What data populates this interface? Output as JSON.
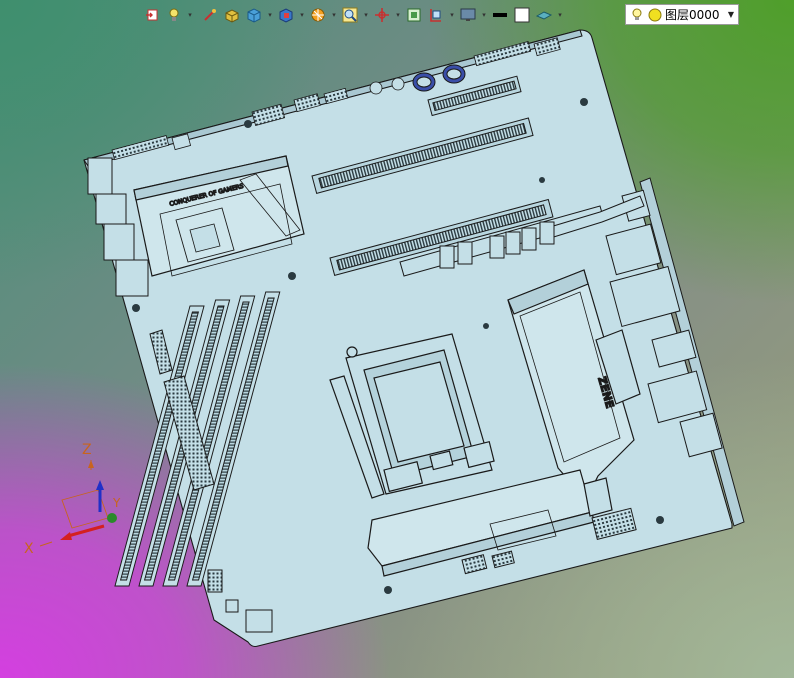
{
  "toolbar": {
    "icons": [
      "exit-sketch-icon",
      "light-bulb-icon",
      "smart-pick-icon",
      "render-box-icon",
      "view-cube-icon",
      "view-orientation-icon",
      "display-style-icon",
      "zoom-icon",
      "origin-icon",
      "fit-icon",
      "section-icon",
      "monitor-icon",
      "line-color-icon",
      "fill-color-icon",
      "plane-icon"
    ]
  },
  "layer": {
    "current": "图层0000"
  },
  "triad": {
    "x_label": "X",
    "y_label": "Y",
    "z_label": "Z"
  },
  "model": {
    "board_text": "ZENE",
    "heatsink_text": "CONQUERER OF GAMERS"
  },
  "colors": {
    "board_fill": "#c4dfe7",
    "edge": "#1a1a1a",
    "axis_x": "#d42020",
    "axis_y": "#2a8a2a",
    "axis_z": "#2030c8",
    "axis_label": "#c8641e"
  }
}
